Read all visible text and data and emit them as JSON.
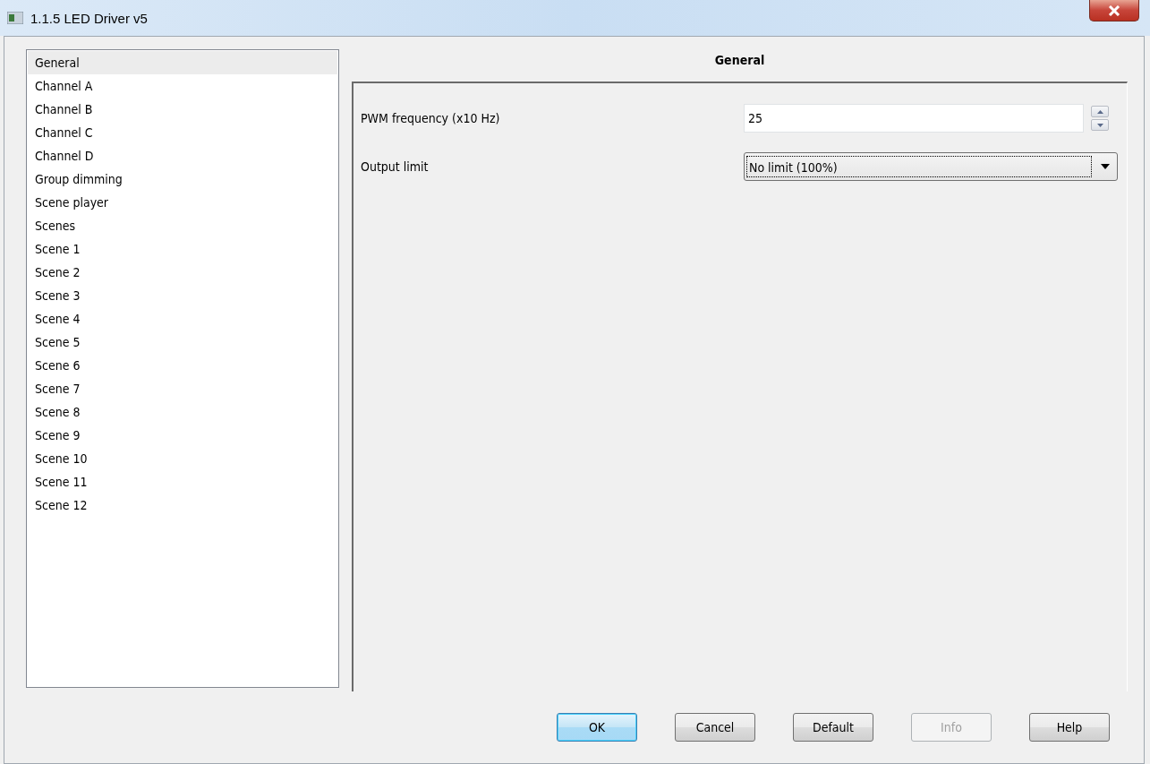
{
  "window": {
    "title": "1.1.5 LED Driver v5"
  },
  "sidebar": {
    "items": [
      {
        "label": "General",
        "selected": true
      },
      {
        "label": "Channel A",
        "selected": false
      },
      {
        "label": "Channel B",
        "selected": false
      },
      {
        "label": "Channel C",
        "selected": false
      },
      {
        "label": "Channel D",
        "selected": false
      },
      {
        "label": "Group dimming",
        "selected": false
      },
      {
        "label": "Scene player",
        "selected": false
      },
      {
        "label": "Scenes",
        "selected": false
      },
      {
        "label": "Scene 1",
        "selected": false
      },
      {
        "label": "Scene 2",
        "selected": false
      },
      {
        "label": "Scene 3",
        "selected": false
      },
      {
        "label": "Scene 4",
        "selected": false
      },
      {
        "label": "Scene 5",
        "selected": false
      },
      {
        "label": "Scene 6",
        "selected": false
      },
      {
        "label": "Scene 7",
        "selected": false
      },
      {
        "label": "Scene 8",
        "selected": false
      },
      {
        "label": "Scene 9",
        "selected": false
      },
      {
        "label": "Scene 10",
        "selected": false
      },
      {
        "label": "Scene 11",
        "selected": false
      },
      {
        "label": "Scene 12",
        "selected": false
      }
    ]
  },
  "panel": {
    "title": "General",
    "parameters": [
      {
        "kind": "spinner",
        "label": "PWM frequency (x10 Hz)",
        "value": "25"
      },
      {
        "kind": "dropdown",
        "label": "Output limit",
        "value": "No limit (100%)"
      }
    ]
  },
  "buttons": [
    {
      "label": "OK",
      "default": true,
      "disabled": false
    },
    {
      "label": "Cancel",
      "default": false,
      "disabled": false
    },
    {
      "label": "Default",
      "default": false,
      "disabled": false
    },
    {
      "label": "Info",
      "default": false,
      "disabled": true
    },
    {
      "label": "Help",
      "default": false,
      "disabled": false
    }
  ]
}
